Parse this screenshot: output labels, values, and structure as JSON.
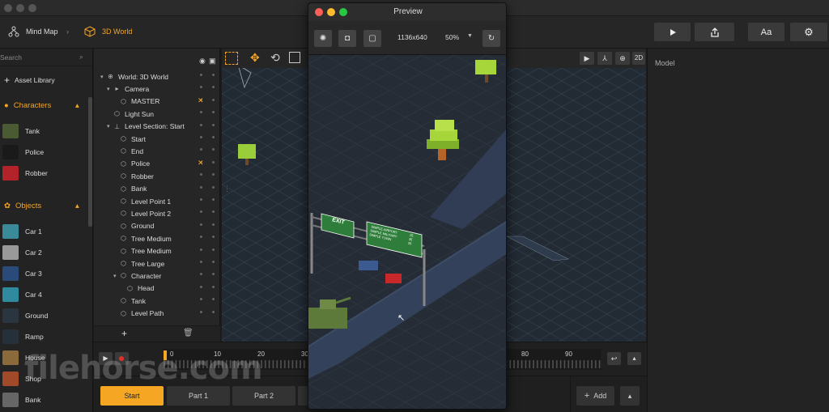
{
  "breadcrumb": {
    "root": "Mind Map",
    "current": "3D World"
  },
  "toolbar": {
    "font_button": "Aa"
  },
  "assets": {
    "search_placeholder": "Search",
    "library_label": "Asset Library",
    "characters_header": "Characters",
    "characters": [
      "Tank",
      "Police",
      "Robber"
    ],
    "objects_header": "Objects",
    "objects": [
      "Car 1",
      "Car 2",
      "Car 3",
      "Car 4",
      "Ground",
      "Ramp",
      "House",
      "Shop",
      "Bank"
    ]
  },
  "hierarchy": {
    "items": [
      "World: 3D World",
      "Camera",
      "MASTER",
      "Light Sun",
      "Level Section: Start",
      "Start",
      "End",
      "Police",
      "Robber",
      "Bank",
      "Level Point 1",
      "Level Point 2",
      "Ground",
      "Tree Medium",
      "Tree Medium",
      "Tree Large",
      "Character",
      "Head",
      "Tank",
      "Level Path"
    ]
  },
  "viewport": {
    "mode_2d": "2D"
  },
  "inspector": {
    "title": "Model"
  },
  "timeline": {
    "ticks": [
      "0",
      "10",
      "20",
      "30",
      "80",
      "90"
    ]
  },
  "sections": {
    "tabs": [
      "Start",
      "Part 1",
      "Part 2"
    ],
    "add_label": "Add"
  },
  "preview": {
    "title": "Preview",
    "resolution": "1136x640",
    "zoom": "50%",
    "sign_exit": "EXIT",
    "sign_lines": [
      "SIMPLE AIRPORT",
      "SIMPLE MILITARY",
      "SIMPLE TOWN"
    ],
    "sign_nums": [
      "25",
      "35",
      "20"
    ]
  },
  "watermark": "filehorse.com",
  "colors": {
    "accent": "#f5a623",
    "active_tab": "#f5a623"
  }
}
